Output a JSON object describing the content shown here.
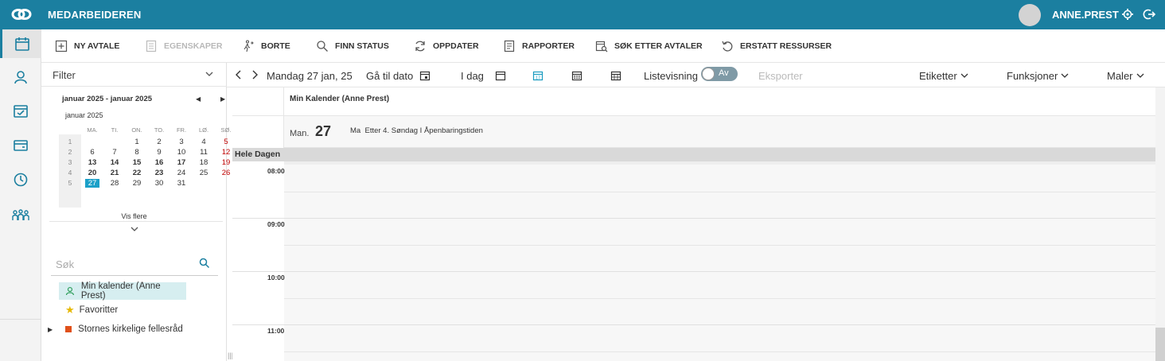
{
  "brand_color": "#1b7fa0",
  "topbar": {
    "app_title": "MEDARBEIDEREN",
    "username": "ANNE.PREST"
  },
  "leftnav": [
    "calendar-icon",
    "person-icon",
    "calendar-check-icon",
    "card-icon",
    "clock-icon",
    "group-icon"
  ],
  "toolbar": {
    "new_appointment": "NY AVTALE",
    "properties": "EGENSKAPER",
    "away": "BORTE",
    "find_status": "FINN STATUS",
    "refresh": "OPPDATER",
    "reports": "RAPPORTER",
    "search_appointments": "SØK ETTER AVTALER",
    "replace_resources": "ERSTATT RESSURSER"
  },
  "sidebar": {
    "filter_label": "Filter",
    "mini_cal": {
      "range": "januar 2025 - januar 2025",
      "month": "januar 2025",
      "headers": [
        "MA.",
        "TI.",
        "ON.",
        "TO.",
        "FR.",
        "LØ.",
        "SØ."
      ],
      "weeks": [
        {
          "wk": "1",
          "days": [
            "",
            "",
            "1",
            "2",
            "3",
            "4",
            "5"
          ]
        },
        {
          "wk": "2",
          "days": [
            "6",
            "7",
            "8",
            "9",
            "10",
            "11",
            "12"
          ]
        },
        {
          "wk": "3",
          "days": [
            "13",
            "14",
            "15",
            "16",
            "17",
            "18",
            "19"
          ]
        },
        {
          "wk": "4",
          "days": [
            "20",
            "21",
            "22",
            "23",
            "24",
            "25",
            "26"
          ]
        },
        {
          "wk": "5",
          "days": [
            "27",
            "28",
            "29",
            "30",
            "31",
            "",
            ""
          ]
        }
      ],
      "today": "27"
    },
    "show_more": "Vis flere",
    "search_placeholder": "Søk",
    "tree": {
      "my_calendar": "Min kalender (Anne Prest)",
      "favorites": "Favoritter",
      "org": "Stornes kirkelige fellesråd"
    }
  },
  "calbar": {
    "date_label": "Mandag 27 jan, 25",
    "goto_date": "Gå til dato",
    "today": "I dag",
    "day_icon_number": "17",
    "list_view": "Listevisning",
    "toggle_state": "Av",
    "export": "Eksporter",
    "labels": "Etiketter",
    "functions": "Funksjoner",
    "templates": "Maler"
  },
  "calendar": {
    "owner": "Min Kalender (Anne Prest)",
    "day_abbr": "Man.",
    "day_num": "27",
    "event_prefix": "Ma",
    "event_text": "Etter 4. Søndag I Åpenbaringstiden",
    "all_day": "Hele Dagen",
    "hours": [
      "08:00",
      "09:00",
      "10:00",
      "11:00"
    ]
  }
}
